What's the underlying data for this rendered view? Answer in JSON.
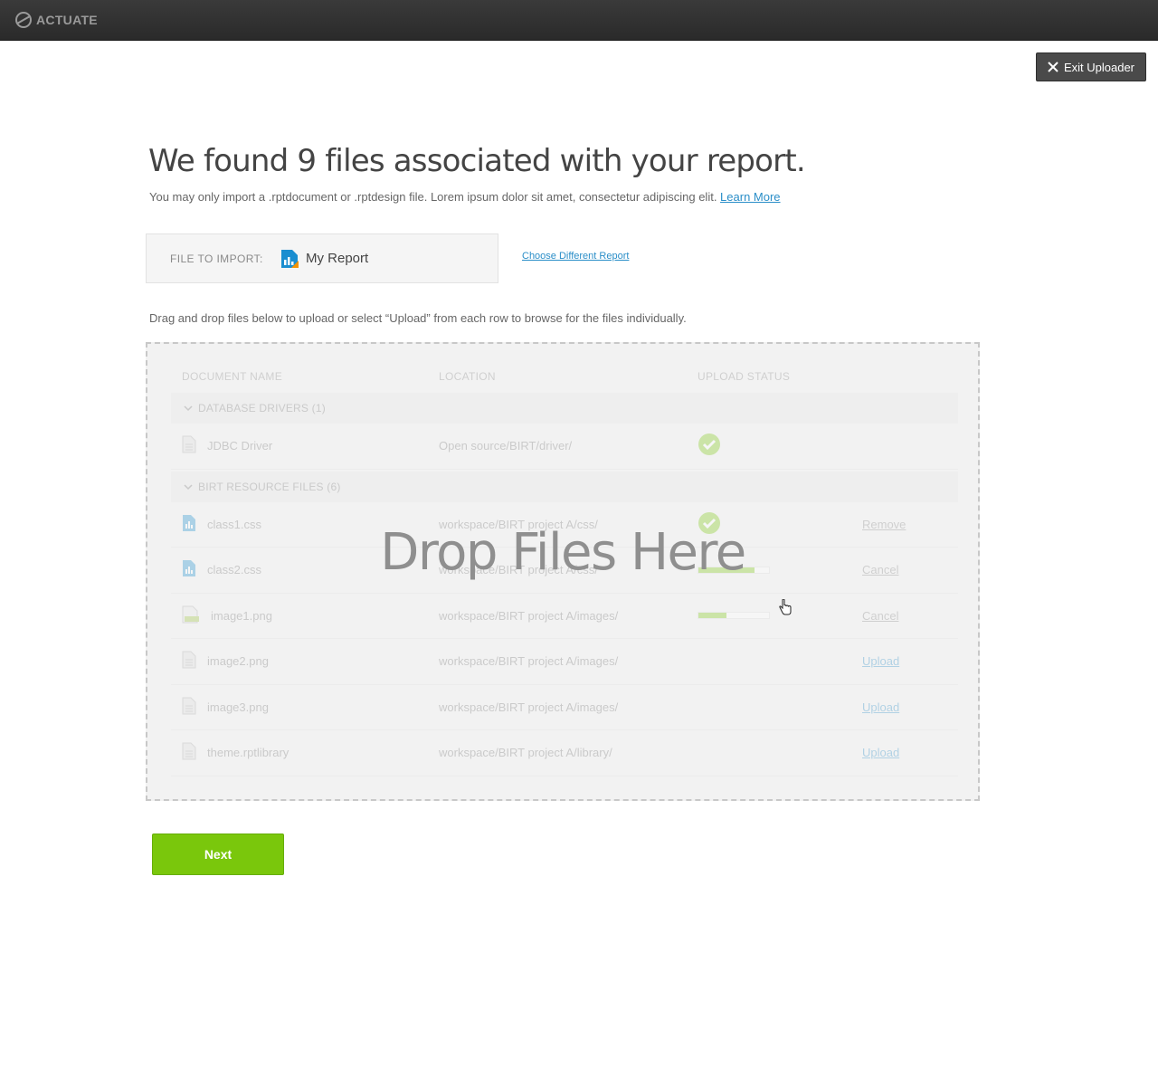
{
  "brand": {
    "name": "ACTUATE"
  },
  "header": {
    "exit_label": "Exit Uploader"
  },
  "page": {
    "title": "We found 9 files associated with your report.",
    "subtext": "You may only import a .rptdocument or .rptdesign file. Lorem ipsum dolor sit amet, consectetur adipiscing elit. ",
    "learn_more": "Learn More",
    "import_label": "FILE TO IMPORT:",
    "import_file": "My Report",
    "choose_link": "Choose Different Report",
    "instructions": "Drag and drop files below to upload or select “Upload” from each row to browse for the files individually."
  },
  "table": {
    "headers": [
      "DOCUMENT NAME",
      "LOCATION",
      "UPLOAD STATUS"
    ],
    "groups": [
      {
        "label": "DATABASE DRIVERS (1)",
        "rows": [
          {
            "name": "JDBC Driver",
            "location": "Open source/BIRT/driver/",
            "icon": "document-icon",
            "status": "done",
            "action": ""
          }
        ]
      },
      {
        "label": "BIRT RESOURCE FILES (6)",
        "rows": [
          {
            "name": "class1.css",
            "location": "workspace/BIRT project A/css/",
            "icon": "chart-file-icon",
            "status": "done",
            "action": "Remove"
          },
          {
            "name": "class2.css",
            "location": "workspace/BIRT project A/css/",
            "icon": "chart-file-icon",
            "status": "progress",
            "progress": 0.8,
            "action": "Cancel"
          },
          {
            "name": "image1.png",
            "location": "workspace/BIRT project A/images/",
            "icon": "image-file-icon",
            "status": "progress",
            "progress": 0.4,
            "action": "Cancel"
          },
          {
            "name": "image2.png",
            "location": "workspace/BIRT project A/images/",
            "icon": "document-icon",
            "status": "none",
            "action": "Upload"
          },
          {
            "name": "image3.png",
            "location": "workspace/BIRT project A/images/",
            "icon": "document-icon",
            "status": "none",
            "action": "Upload"
          },
          {
            "name": "theme.rptlibrary",
            "location": "workspace/BIRT project A/library/",
            "icon": "document-icon",
            "status": "none",
            "action": "Upload"
          }
        ]
      }
    ]
  },
  "dropzone": {
    "label": "Drop Files Here"
  },
  "footer": {
    "next_label": "Next"
  },
  "colors": {
    "accent": "#7ac70c",
    "link": "#2a8ec8",
    "topbar": "#2f2f2f"
  }
}
